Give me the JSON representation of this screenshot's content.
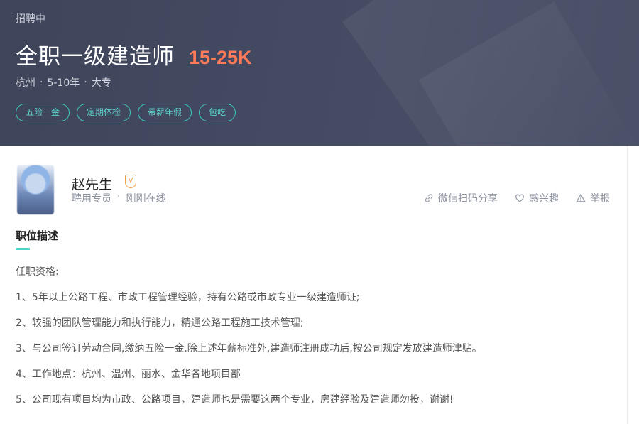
{
  "header": {
    "status": "招聘中",
    "job_title": "全职一级建造师",
    "salary": "15-25K",
    "meta": {
      "city": "杭州",
      "experience": "5-10年",
      "education": "大专",
      "separator": "·"
    },
    "tags": [
      "五险一金",
      "定期体检",
      "带薪年假",
      "包吃"
    ]
  },
  "recruiter": {
    "name": "赵先生",
    "verified_badge": "V",
    "role": "聘用专员",
    "separator": "·",
    "online_status": "刚刚在线"
  },
  "actions": {
    "share": {
      "label": "微信扫码分享",
      "icon": "link-icon"
    },
    "interest": {
      "label": "感兴趣",
      "icon": "heart-icon"
    },
    "report": {
      "label": "举报",
      "icon": "warning-icon"
    }
  },
  "description": {
    "title": "职位描述",
    "lines": [
      "任职资格:",
      "1、5年以上公路工程、市政工程管理经验，持有公路或市政专业一级建造师证;",
      "2、较强的团队管理能力和执行能力，精通公路工程施工技术管理;",
      "3、与公司签订劳动合同,缴纳五险一金.除上述年薪标准外,建造师注册成功后,按公司规定发放建造师津贴。",
      "4、工作地点：杭州、温州、丽水、金华各地项目部",
      "5、公司现有项目均为市政、公路项目，建造师也是需要这两个专业，房建经验及建造师勿投，谢谢!"
    ]
  },
  "colors": {
    "header_bg": "#434961",
    "salary": "#ff7a59",
    "tag_accent": "#3ec6bc",
    "verify_badge": "#f0a04b"
  }
}
